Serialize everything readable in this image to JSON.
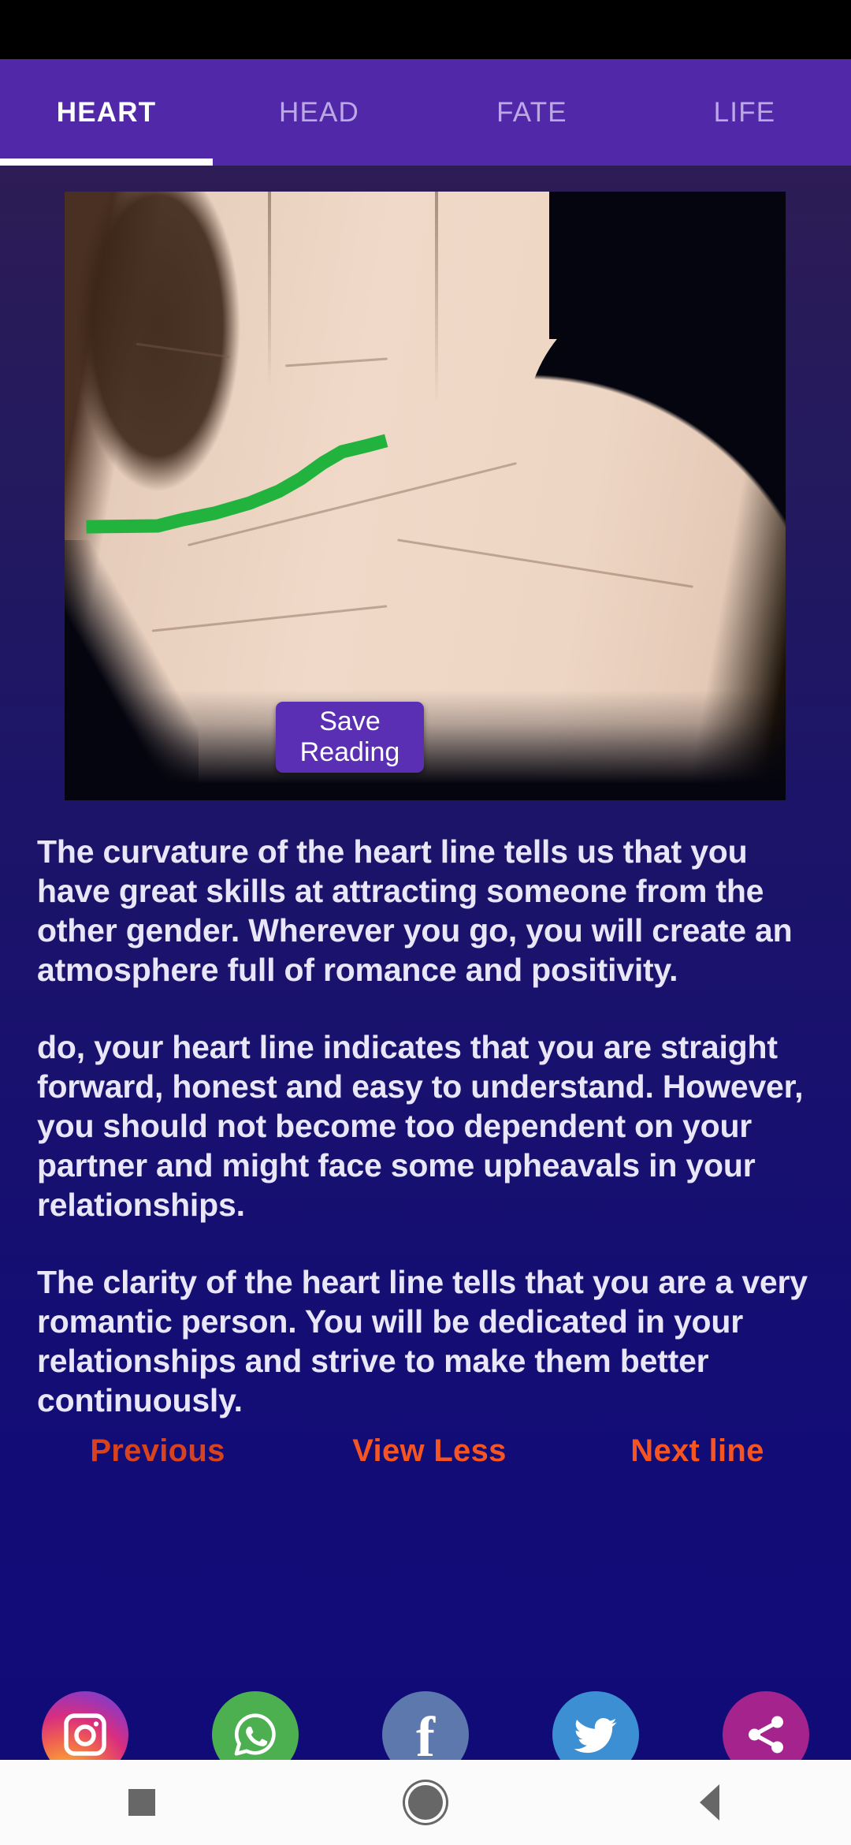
{
  "app": {
    "accent_purple": "#5129a8",
    "accent_orange": "#f65522",
    "accent_orange_dim": "#d8431f",
    "line_color": "#22b33f",
    "bg_gradient_top": "#2d1c55",
    "bg_gradient_bottom": "#110b78"
  },
  "tabs": [
    {
      "label": "HEART",
      "active": true
    },
    {
      "label": "HEAD",
      "active": false
    },
    {
      "label": "FATE",
      "active": false
    },
    {
      "label": "LIFE",
      "active": false
    }
  ],
  "photo": {
    "alt": "palm-photo-with-traced-heart-line",
    "traced_line_name": "heart-line-overlay"
  },
  "save_button": {
    "label": "Save Reading"
  },
  "reading": {
    "paragraphs": [
      "The curvature of the heart line tells us that you have great skills at attracting someone from the other gender. Wherever you go, you will create an atmosphere full of romance and positivity.",
      "do, your heart line indicates that you are straight forward, honest and easy to understand. However, you should not become too dependent on your partner and might face some upheavals in your relationships.",
      "The clarity of the heart line tells that you are a very romantic person. You will be dedicated in your relationships and strive to make them better continuously."
    ]
  },
  "nav_links": {
    "previous": "Previous",
    "view_less": "View Less",
    "next_line": "Next line"
  },
  "social": [
    {
      "name": "instagram-share-button",
      "icon": "instagram-icon"
    },
    {
      "name": "whatsapp-share-button",
      "icon": "whatsapp-icon"
    },
    {
      "name": "facebook-share-button",
      "icon": "facebook-icon"
    },
    {
      "name": "twitter-share-button",
      "icon": "twitter-icon"
    },
    {
      "name": "generic-share-button",
      "icon": "share-icon"
    }
  ],
  "system_nav": {
    "recents": "recents-square-icon",
    "home": "home-circle-icon",
    "back": "back-triangle-icon"
  }
}
